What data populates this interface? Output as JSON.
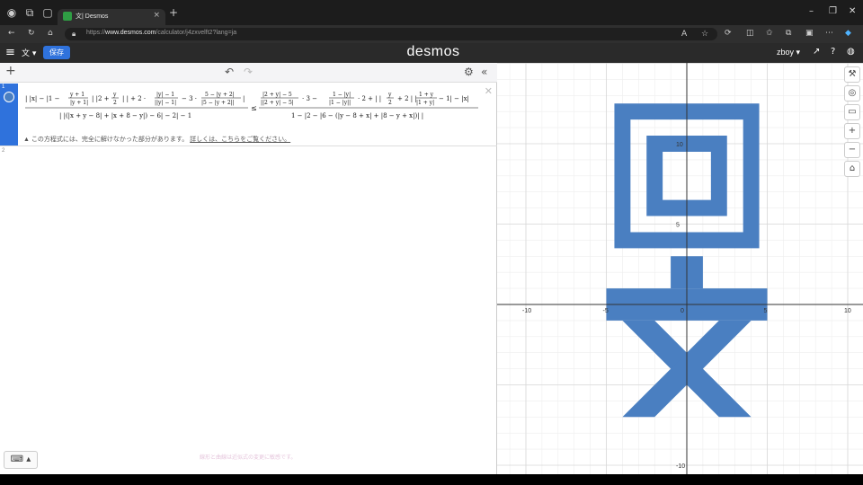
{
  "browser": {
    "tab_title": "文| Desmos",
    "url_prefix": "https://",
    "url_domain": "www.desmos.com",
    "url_path": "/calculator/j4zxvelft2?lang=ja"
  },
  "header": {
    "lang_label": "文",
    "save_label": "保存",
    "logo": "desmos",
    "user_label": "zboy"
  },
  "expressions": [
    {
      "index": "1",
      "color": "#4a7fc1",
      "warning_text": "この方程式には、完全に解けなかった部分があります。",
      "warning_link": "詳しくは、こちらをご覧ください。"
    },
    {
      "index": "2"
    }
  ],
  "footer_note": "線形と曲線は近似式の変更に敏感です。",
  "graph": {
    "x_ticks": [
      "-10",
      "-5",
      "0",
      "5",
      "10"
    ],
    "y_ticks": [
      "10",
      "5",
      "-10"
    ],
    "fill_color": "#4a7fc1"
  }
}
